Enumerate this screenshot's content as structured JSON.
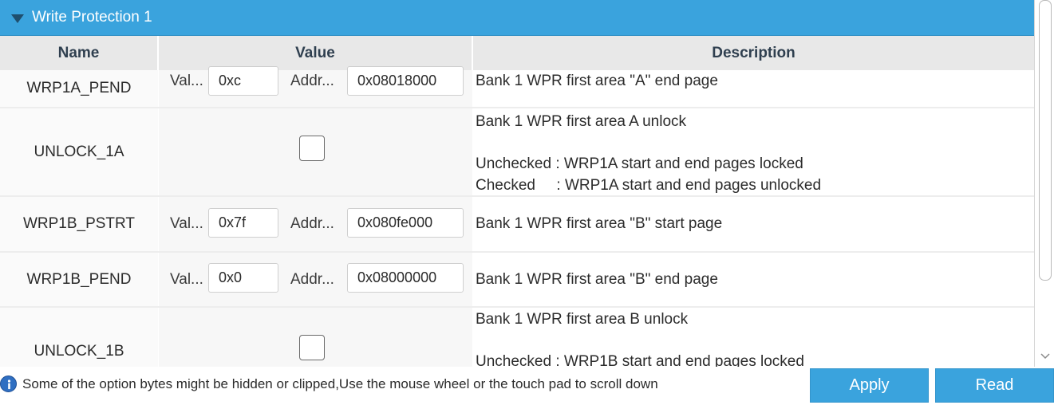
{
  "section": {
    "title": "Write Protection 1"
  },
  "columns": {
    "name": "Name",
    "value": "Value",
    "description": "Description"
  },
  "rows": [
    {
      "name": "WRP1A_PEND",
      "value_label": "Val...",
      "value": "0xc",
      "address_label": "Addr...",
      "address": "0x08018000",
      "description": "Bank 1 WPR first area \"A\" end page"
    },
    {
      "name": "UNLOCK_1A",
      "checked": false,
      "description_lines": [
        "Bank 1 WPR first area A unlock",
        "Unchecked : WRP1A start and end pages locked",
        "Checked     : WRP1A start and end pages unlocked"
      ]
    },
    {
      "name": "WRP1B_PSTRT",
      "value_label": "Val...",
      "value": "0x7f",
      "address_label": "Addr...",
      "address": "0x080fe000",
      "description": "Bank 1 WPR first area \"B\" start page"
    },
    {
      "name": "WRP1B_PEND",
      "value_label": "Val...",
      "value": "0x0",
      "address_label": "Addr...",
      "address": "0x08000000",
      "description": "Bank 1 WPR first area \"B\" end page"
    },
    {
      "name": "UNLOCK_1B",
      "checked": false,
      "description_lines": [
        "Bank 1 WPR first area B unlock",
        "Unchecked : WRP1B start and end pages locked"
      ]
    }
  ],
  "footer": {
    "info_icon": "info-icon",
    "info_text": "Some of the option bytes might be hidden or clipped,Use the mouse wheel or the touch pad to scroll down",
    "apply_label": "Apply",
    "read_label": "Read"
  },
  "colors": {
    "accent": "#3aa3dd",
    "header_bg": "#e8e8e8"
  }
}
